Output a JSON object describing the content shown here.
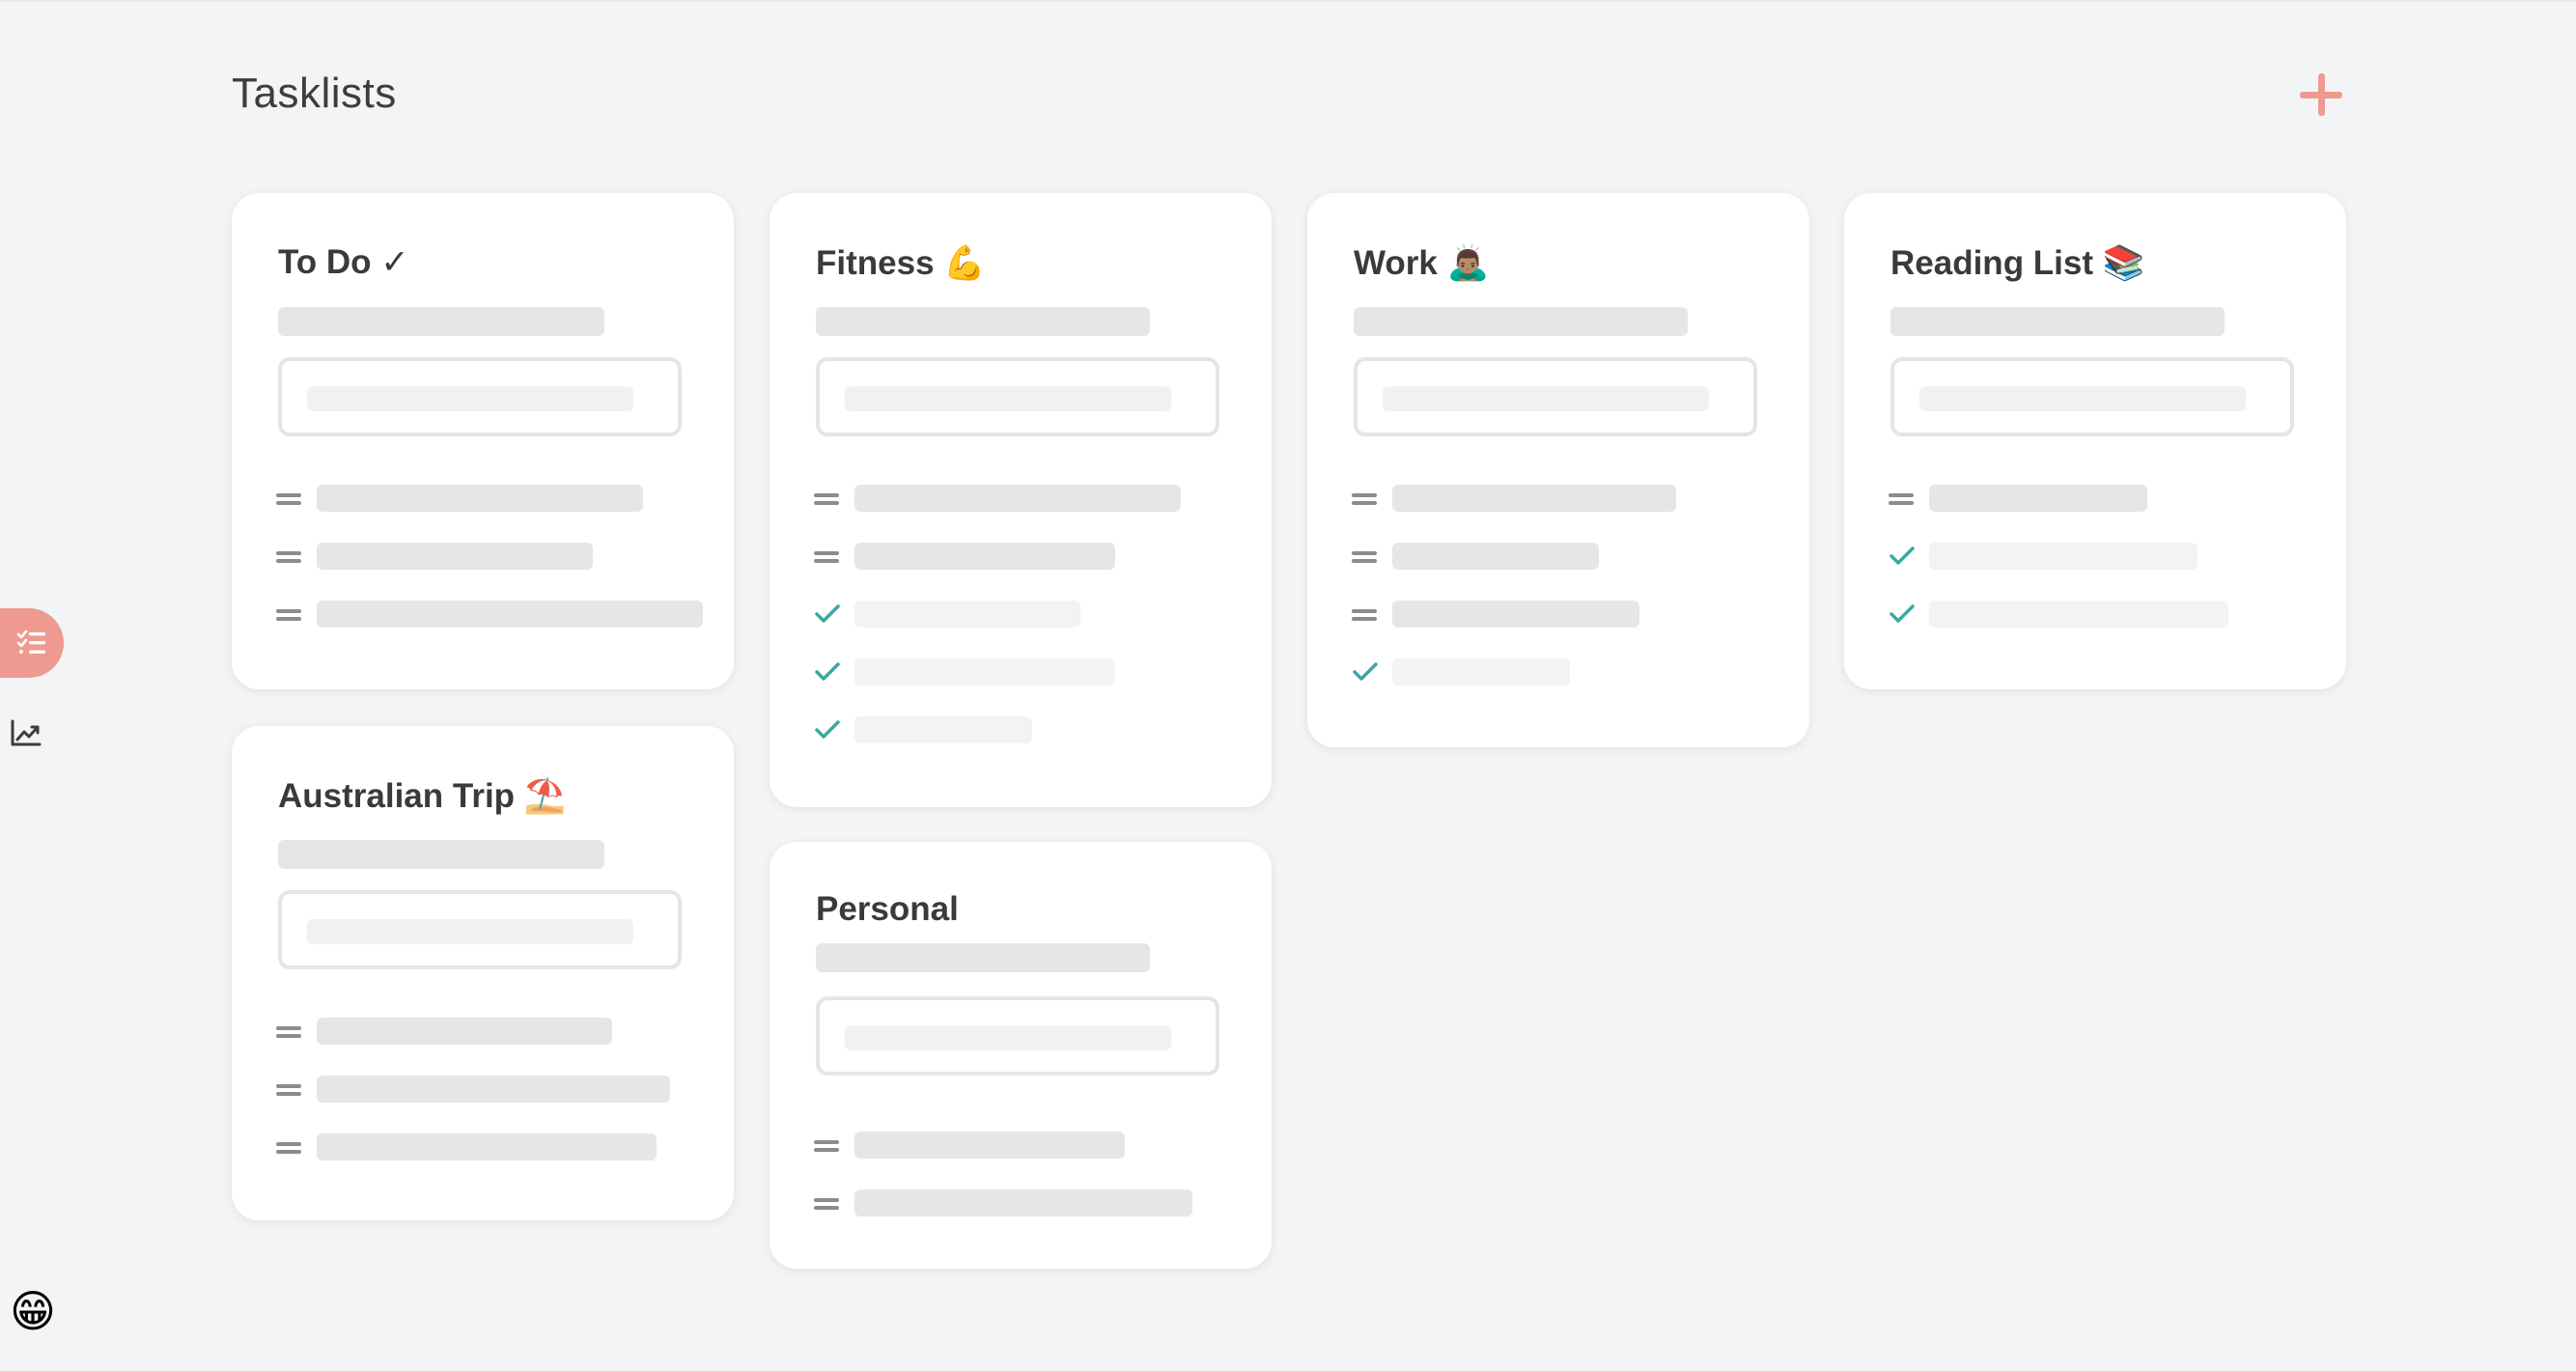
{
  "header": {
    "title": "Tasklists",
    "add_icon": "plus-icon",
    "accent_color": "#ee9a90"
  },
  "sidebar": {
    "items": [
      {
        "icon": "tasklist-icon",
        "active": true
      },
      {
        "icon": "chart-icon",
        "active": false
      }
    ],
    "user_emoji": "😁"
  },
  "colors": {
    "background": "#f3f4f6",
    "card": "#ffffff",
    "check": "#3aa99f",
    "placeholder_bar": "#e6e6e6"
  },
  "tasklists": [
    {
      "title": "To Do ✓",
      "tasks": [
        {
          "done": false
        },
        {
          "done": false
        },
        {
          "done": false
        }
      ]
    },
    {
      "title": "Fitness 💪",
      "tasks": [
        {
          "done": false
        },
        {
          "done": false
        },
        {
          "done": true
        },
        {
          "done": true
        },
        {
          "done": true
        }
      ]
    },
    {
      "title": "Work 🙇🏽‍♂️",
      "tasks": [
        {
          "done": false
        },
        {
          "done": false
        },
        {
          "done": false
        },
        {
          "done": true
        }
      ]
    },
    {
      "title": "Reading List 📚",
      "tasks": [
        {
          "done": false
        },
        {
          "done": true
        },
        {
          "done": true
        }
      ]
    },
    {
      "title": "Australian Trip ⛱️",
      "tasks": [
        {
          "done": false
        },
        {
          "done": false
        },
        {
          "done": false
        }
      ]
    },
    {
      "title": "Personal",
      "tasks": [
        {
          "done": false
        },
        {
          "done": false
        }
      ]
    }
  ]
}
